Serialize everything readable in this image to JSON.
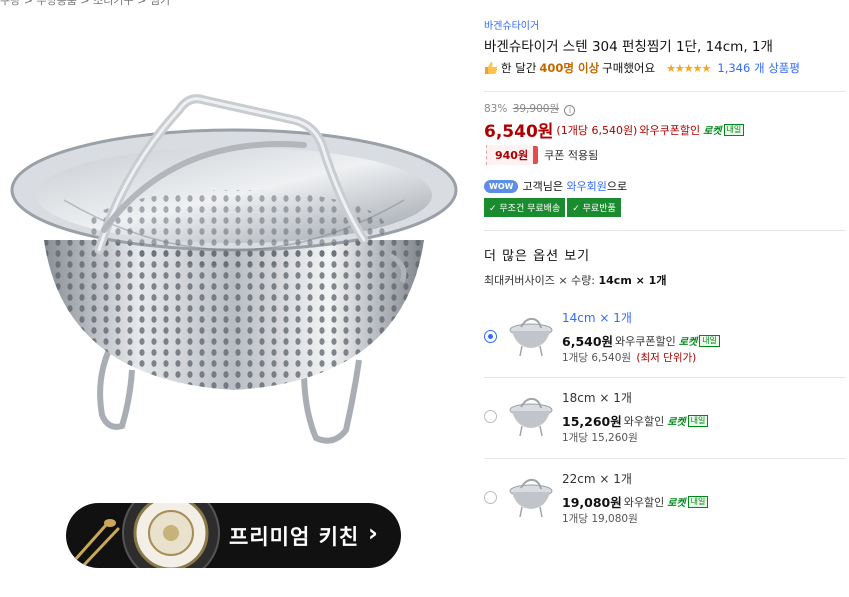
{
  "breadcrumb": "쿠팡 > 주방용품 > 조리기구 > 찜기",
  "product": {
    "brand": "바겐슈타이거",
    "title": "바겐슈타이거 스텐 304 펀칭찜기 1단, 14cm, 1개",
    "social_prefix": "한 달간",
    "social_count": "400명 이상",
    "social_suffix": "구매했어요",
    "stars": "★★★★★",
    "review_count": "1,346 개 상품평"
  },
  "price": {
    "discount_rate": "83%",
    "original": "39,900원",
    "main": "6,540원",
    "unit": "(1개당 6,540원)",
    "wow_label": "와우쿠폰할인",
    "rocket": "로켓",
    "rocket_badge": "내일"
  },
  "coupon": {
    "amount": "940원",
    "label": "쿠폰 적용됨"
  },
  "membership": {
    "pill": "WOW",
    "text_prefix": "고객님은",
    "member_type": "와우회원",
    "text_suffix": "으로"
  },
  "shipping_tags": [
    "✓ 무조건 무료배송",
    "✓ 무료반품"
  ],
  "options": {
    "section_title": "더 많은 옵션 보기",
    "selected_prefix": "최대커버사이즈 × 수량:",
    "selected_value": "14cm × 1개",
    "items": [
      {
        "name": "14cm × 1개",
        "price": "6,540원",
        "label": "와우쿠폰할인",
        "unit": "1개당 6,540원",
        "lowest": "(최저 단위가)",
        "selected": true
      },
      {
        "name": "18cm × 1개",
        "price": "15,260원",
        "label": "와우할인",
        "unit": "1개당 15,260원",
        "lowest": "",
        "selected": false
      },
      {
        "name": "22cm × 1개",
        "price": "19,080원",
        "label": "와우할인",
        "unit": "1개당 19,080원",
        "lowest": "",
        "selected": false
      }
    ]
  },
  "banner": {
    "text": "프리미엄 키친",
    "chevron": "›"
  },
  "colors": {
    "price_red": "#ae0000",
    "link_blue": "#346aff",
    "rocket_green": "#00891a",
    "free_ship_green": "#1a8b2e"
  }
}
